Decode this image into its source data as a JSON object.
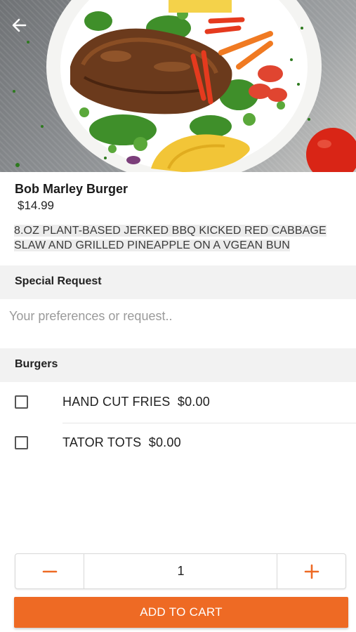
{
  "hero": {
    "image_alt": "jerk chicken plate with salad, mango and tomato",
    "back_icon": "arrow-left-icon"
  },
  "product": {
    "name": "Bob Marley Burger",
    "price": "$14.99",
    "description": "8.OZ PLANT-BASED JERKED BBQ KICKED RED CABBAGE SLAW AND GRILLED PINEAPPLE ON A VGEAN BUN"
  },
  "special_request": {
    "title": "Special Request",
    "placeholder": "Your preferences or request..",
    "value": ""
  },
  "options": {
    "title": "Burgers",
    "items": [
      {
        "label": "HAND CUT FRIES  $0.00",
        "checked": false
      },
      {
        "label": "TATOR TOTS  $0.00",
        "checked": false
      }
    ]
  },
  "quantity": {
    "value": "1",
    "minus_icon": "minus-icon",
    "plus_icon": "plus-icon"
  },
  "actions": {
    "add_to_cart": "ADD TO CART"
  },
  "colors": {
    "accent": "#ee6a24",
    "section_bg": "#f2f2f2"
  }
}
